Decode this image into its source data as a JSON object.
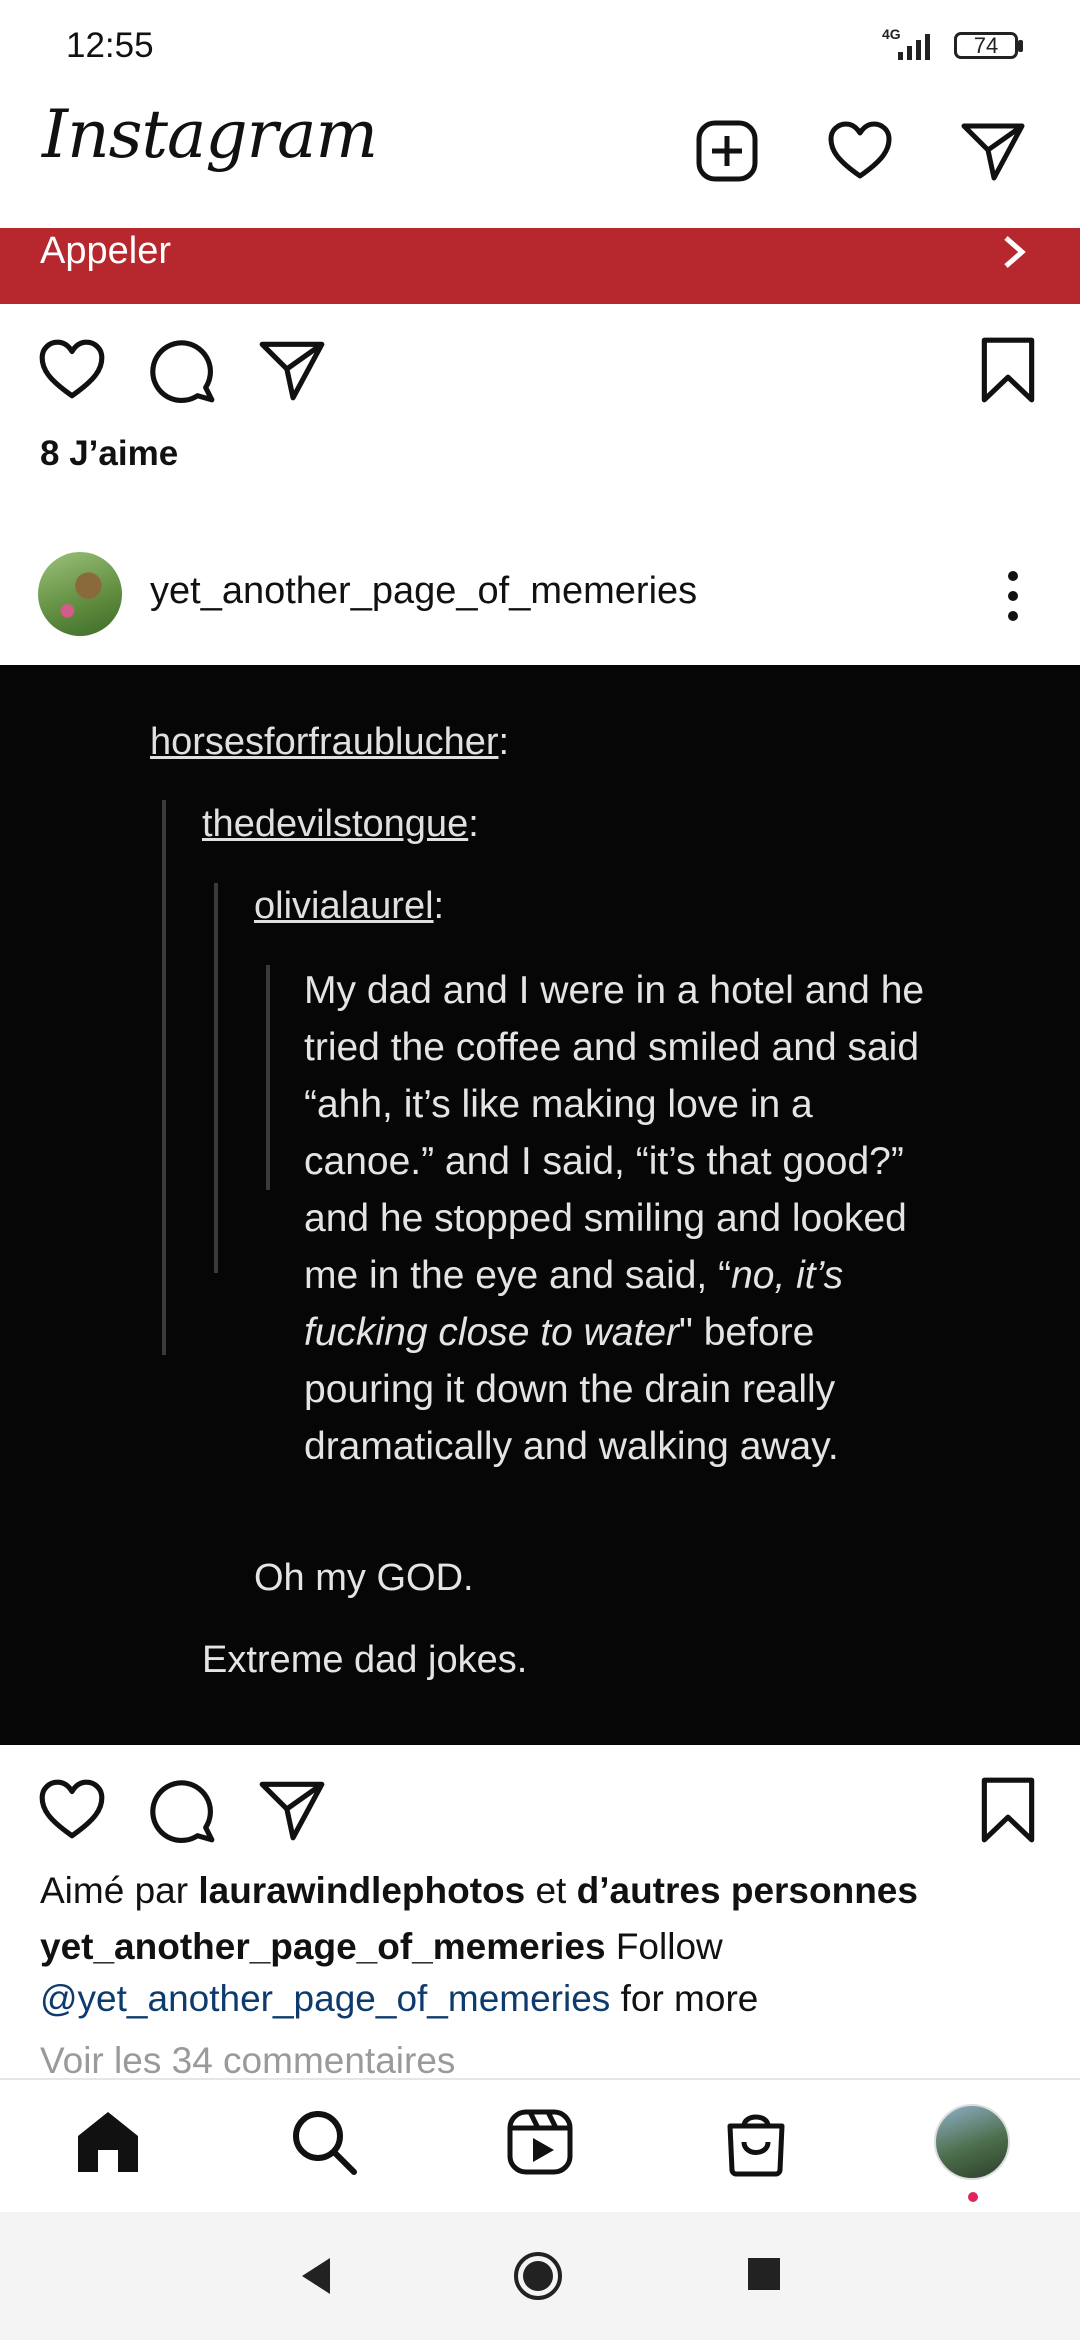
{
  "status_bar": {
    "time": "12:55",
    "network": "4G",
    "battery": "74"
  },
  "header": {
    "logo": "Instagram",
    "icons": [
      "new-post-icon",
      "heart-icon",
      "direct-message-icon"
    ]
  },
  "call_bar": {
    "label": "Appeler",
    "color": "#b7282e"
  },
  "previous_post": {
    "likes": "8 J’aime"
  },
  "post": {
    "username": "yet_another_page_of_memeries",
    "image": {
      "user1": "horsesforfraublucher",
      "user2": "thedevilstongue",
      "user3": "olivialaurel",
      "quote_normal_1": "My dad and I were in a hotel and he tried the coffee and smiled and said “ahh, it’s like making love in a canoe.” and I said, “it’s that good?” and he stopped smiling and looked me in the eye and said, “",
      "quote_italic": "no, it’s fucking close to water",
      "quote_normal_2": "\" before pouring it down the drain really dramatically and walking away.",
      "reply1": "Oh my GOD.",
      "reply2": "Extreme dad jokes."
    },
    "liked_by_prefix": "Aimé par",
    "liked_by_user": "laurawindlephotos",
    "liked_by_and": "et",
    "liked_by_others": "d’autres personnes",
    "caption_username": "yet_another_page_of_memeries",
    "caption_text_1": "Follow",
    "caption_mention": "@yet_another_page_of_memeries",
    "caption_text_2": "for more",
    "view_comments": "Voir les 34 commentaires"
  },
  "bottom_nav": {
    "items": [
      "home-icon",
      "search-icon",
      "reels-icon",
      "shop-icon",
      "profile-avatar"
    ]
  },
  "system_nav": {
    "items": [
      "back-icon",
      "home-circle-icon",
      "recents-icon"
    ]
  }
}
